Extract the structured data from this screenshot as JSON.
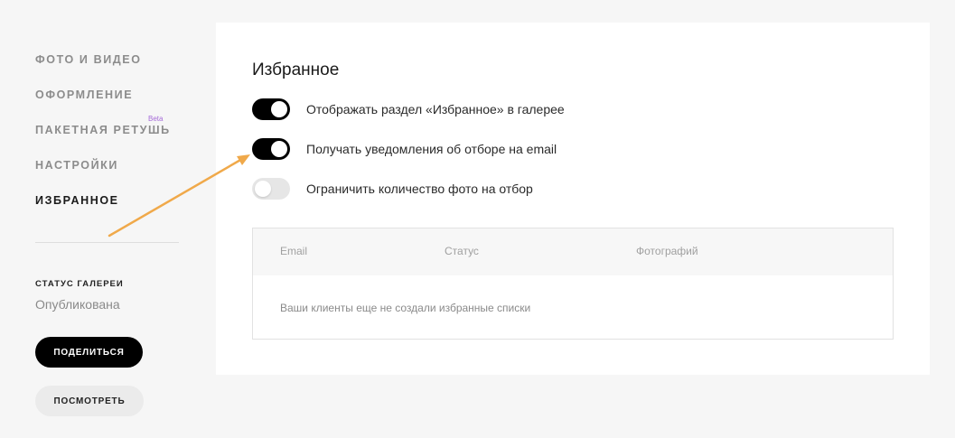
{
  "sidebar": {
    "items": [
      {
        "label": "ФОТО И ВИДЕО"
      },
      {
        "label": "ОФОРМЛЕНИЕ"
      },
      {
        "label": "ПАКЕТНАЯ РЕТУШЬ",
        "badge": "Beta"
      },
      {
        "label": "НАСТРОЙКИ"
      },
      {
        "label": "ИЗБРАННОЕ",
        "active": true
      }
    ],
    "status_heading": "СТАТУС ГАЛЕРЕИ",
    "status_value": "Опубликована",
    "share_label": "ПОДЕЛИТЬСЯ",
    "view_label": "ПОСМОТРЕТЬ"
  },
  "main": {
    "title": "Избранное",
    "toggles": [
      {
        "label": "Отображать раздел «Избранное» в галерее",
        "on": true
      },
      {
        "label": "Получать уведомления об отборе на email",
        "on": true
      },
      {
        "label": "Ограничить количество фото на отбор",
        "on": false
      }
    ],
    "table": {
      "columns": [
        "Email",
        "Статус",
        "Фотографий"
      ],
      "empty_message": "Ваши клиенты еще не создали избранные списки"
    }
  },
  "colors": {
    "accent": "#000000",
    "beta": "#a56bd8",
    "annotation_arrow": "#f0a94a"
  }
}
